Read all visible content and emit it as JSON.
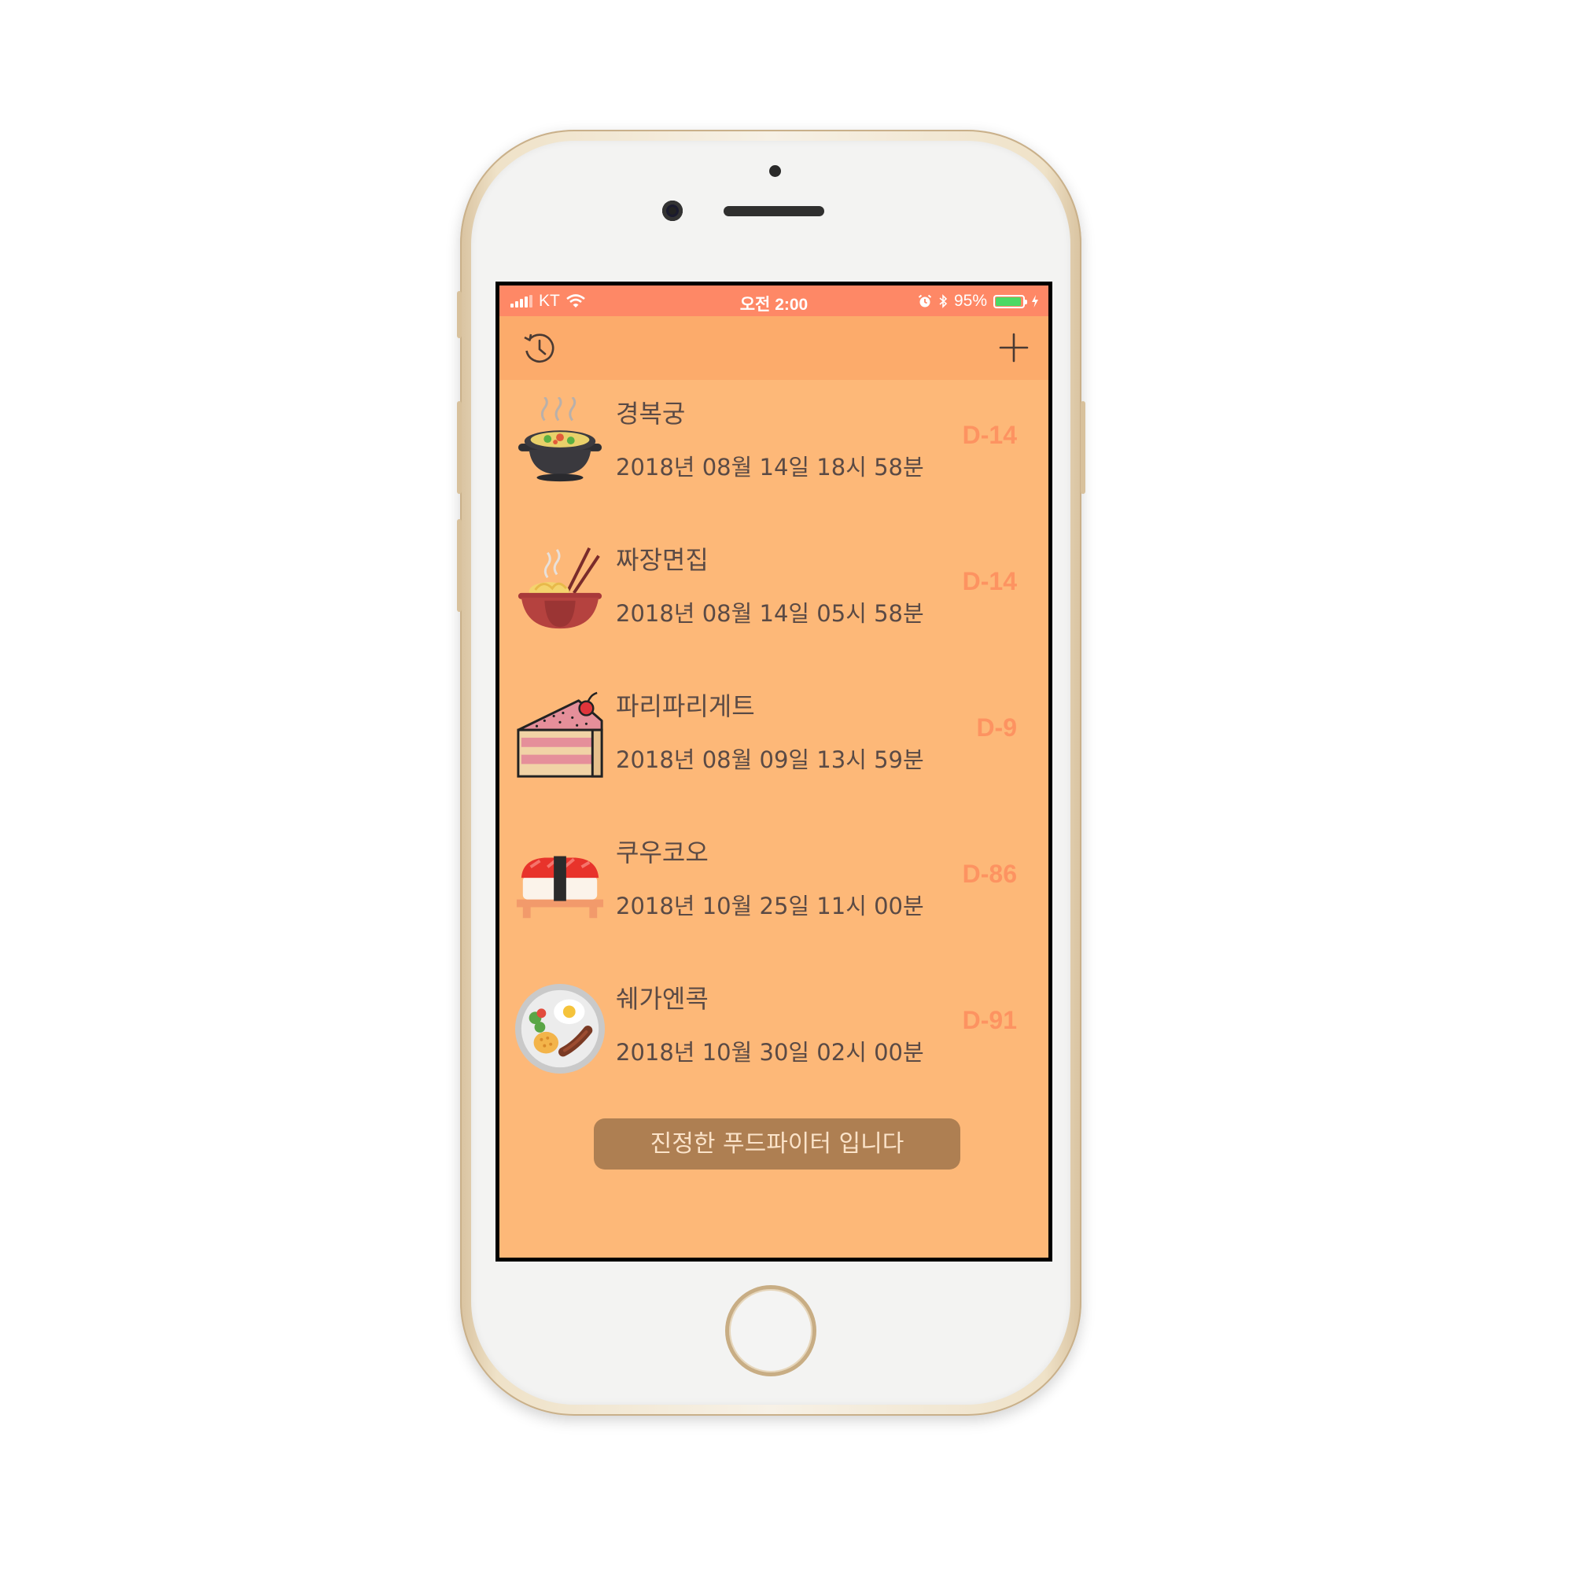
{
  "status_bar": {
    "carrier": "KT",
    "time": "오전 2:00",
    "battery_percent": "95%",
    "battery_level": 0.95,
    "icons": [
      "signal-icon",
      "wifi-icon",
      "alarm-icon",
      "bluetooth-icon",
      "battery-icon",
      "charging-icon"
    ]
  },
  "nav": {
    "left_icon": "history-icon",
    "right_icon": "plus-icon"
  },
  "restaurants": [
    {
      "name": "경복궁",
      "datetime": "2018년 08월 14일 18시 58분",
      "dday": "D-14",
      "icon": "hot-pot-icon"
    },
    {
      "name": "짜장면집",
      "datetime": "2018년 08월 14일 05시 58분",
      "dday": "D-14",
      "icon": "noodle-bowl-icon"
    },
    {
      "name": "파리파리게트",
      "datetime": "2018년 08월 09일 13시 59분",
      "dday": "D-9",
      "icon": "cake-slice-icon"
    },
    {
      "name": "쿠우코오",
      "datetime": "2018년 10월 25일 11시 00분",
      "dday": "D-86",
      "icon": "sushi-icon"
    },
    {
      "name": "쉐가엔콕",
      "datetime": "2018년 10월 30일 02시 00분",
      "dday": "D-91",
      "icon": "breakfast-plate-icon"
    }
  ],
  "footer_button": "진정한 푸드파이터 입니다",
  "colors": {
    "status_bar": "#fe8866",
    "nav_bar": "#fcab6b",
    "background": "#fdb878",
    "dday_text": "#fd9361",
    "button": "#ae7f52"
  }
}
